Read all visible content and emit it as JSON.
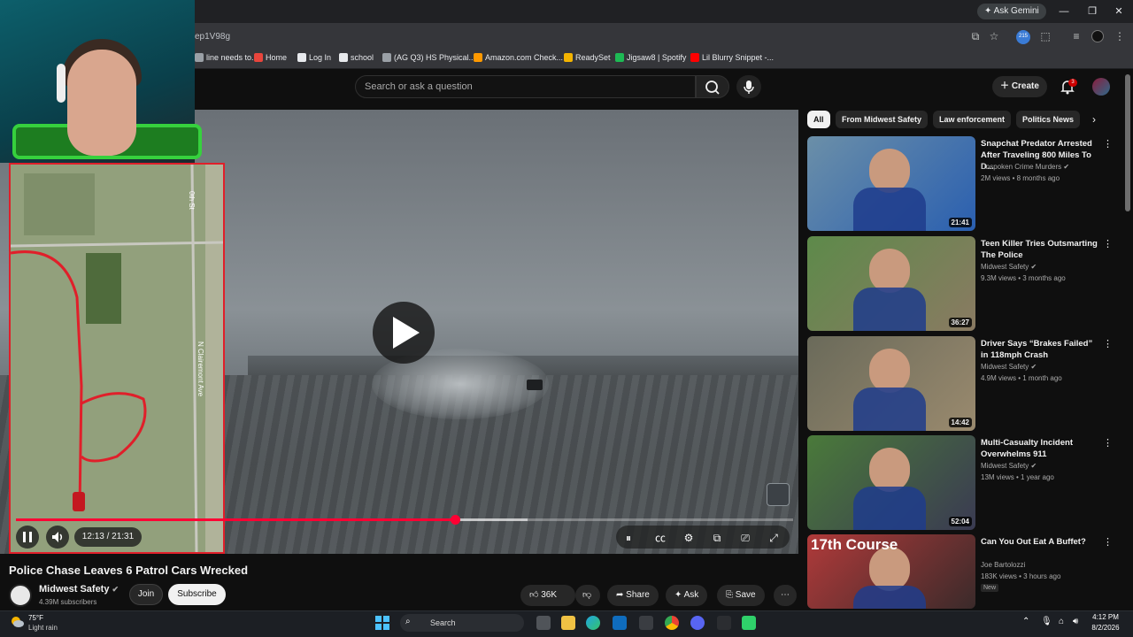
{
  "browser": {
    "url_fragment": "ep1V98g",
    "gemini_label": "Ask Gemini",
    "bookmarks": [
      {
        "label": "line needs to..",
        "color": "#9aa0a6"
      },
      {
        "label": "Home",
        "color": "#e8453c"
      },
      {
        "label": "Log In",
        "color": "#e8eaed"
      },
      {
        "label": "school",
        "color": "#e8eaed"
      },
      {
        "label": "(AG Q3) HS Physical...",
        "color": "#9aa0a6"
      },
      {
        "label": "Amazon.com Check...",
        "color": "#ff9900"
      },
      {
        "label": "ReadySet",
        "color": "#f4b400"
      },
      {
        "label": "Jigsaw8 | Spotify",
        "color": "#1db954"
      },
      {
        "label": "Lil Blurry Snippet -...",
        "color": "#ff0000"
      }
    ],
    "extension_badge": "215"
  },
  "header": {
    "search_placeholder": "Search or ask a question",
    "create_label": "Create",
    "notification_count": "3"
  },
  "player": {
    "time_display": "12:13 / 21:31",
    "progress_fraction": 0.565,
    "buffered_fraction": 0.658,
    "map_labels": {
      "street_top": "0th St",
      "street_side": "N Clairemont Ave"
    }
  },
  "video": {
    "title": "Police Chase Leaves 6 Patrol Cars Wrecked",
    "channel": "Midwest Safety",
    "subscribers": "4.39M subscribers",
    "join_label": "Join",
    "subscribe_label": "Subscribe",
    "likes": "36K",
    "share_label": "Share",
    "ask_label": "Ask",
    "save_label": "Save"
  },
  "sidebar": {
    "chips": [
      "All",
      "From Midwest Safety",
      "Law enforcement",
      "Politics News"
    ],
    "videos": [
      {
        "title": "Snapchat Predator Arrested After Traveling 800 Miles To D...",
        "channel": "Unspoken Crime Murders",
        "meta": "2M views • 8 months ago",
        "duration": "21:41",
        "colors": [
          "#6b8fa8",
          "#2a5fb0"
        ]
      },
      {
        "title": "Teen Killer Tries Outsmarting The Police",
        "channel": "Midwest Safety",
        "meta": "9.3M views • 3 months ago",
        "duration": "36:27",
        "colors": [
          "#5d8a4a",
          "#8a7a62"
        ]
      },
      {
        "title": "Driver Says “Brakes Failed” in 118mph Crash",
        "channel": "Midwest Safety",
        "meta": "4.9M views • 1 month ago",
        "duration": "14:42",
        "colors": [
          "#6a6a5a",
          "#9a8a6e"
        ]
      },
      {
        "title": "Multi-Casualty Incident Overwhelms 911",
        "channel": "Midwest Safety",
        "meta": "13M views • 1 year ago",
        "duration": "52:04",
        "colors": [
          "#4a7a3a",
          "#3a3a52"
        ]
      },
      {
        "title": "Can You Out Eat A Buffet?",
        "channel": "Joe Bartolozzi",
        "meta": "183K views • 3 hours ago",
        "duration": "",
        "badge": "New",
        "thumb_text": "17th Course",
        "colors": [
          "#b03a3a",
          "#3a2a2a"
        ]
      }
    ]
  },
  "taskbar": {
    "temperature": "75°F",
    "condition": "Light rain",
    "search_label": "Search",
    "time": "4:12 PM",
    "date": "8/2/2026"
  }
}
